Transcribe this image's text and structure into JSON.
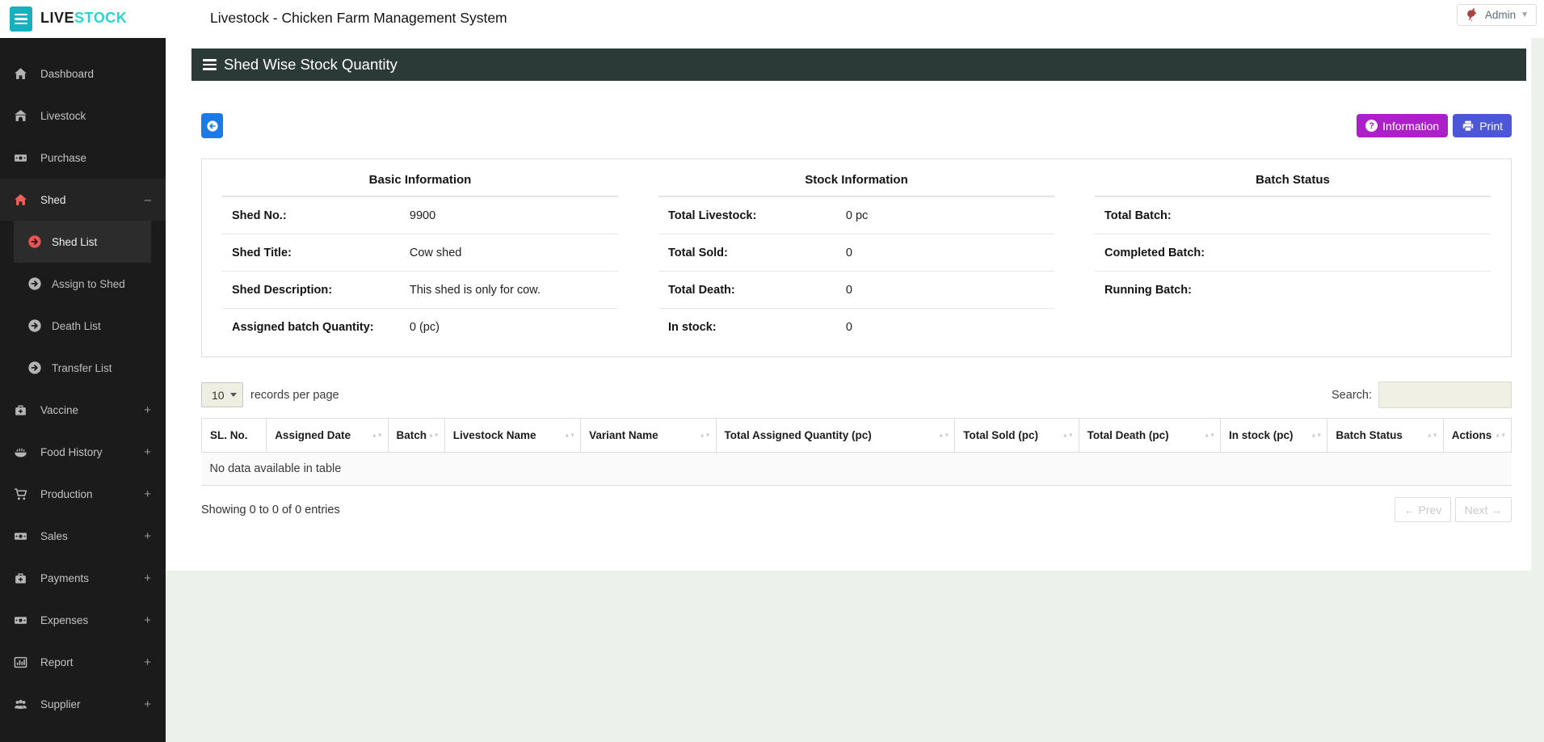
{
  "brand": {
    "logo_prefix": "LIVE",
    "logo_suffix": "STOCK"
  },
  "topbar": {
    "title": "Livestock - Chicken Farm Management System",
    "user_label": "Admin"
  },
  "sidebar": {
    "items": [
      {
        "label": "Dashboard",
        "icon": "home-icon"
      },
      {
        "label": "Livestock",
        "icon": "barn-icon"
      },
      {
        "label": "Purchase",
        "icon": "money-icon"
      },
      {
        "label": "Shed",
        "icon": "home-icon",
        "toggle": "–",
        "state": "expanded",
        "children": [
          {
            "label": "Shed List",
            "active": true
          },
          {
            "label": "Assign to Shed"
          },
          {
            "label": "Death List"
          },
          {
            "label": "Transfer List"
          }
        ]
      },
      {
        "label": "Vaccine",
        "icon": "medkit-icon",
        "toggle": "+"
      },
      {
        "label": "Food History",
        "icon": "food-bowl-icon",
        "toggle": "+"
      },
      {
        "label": "Production",
        "icon": "cart-icon",
        "toggle": "+"
      },
      {
        "label": "Sales",
        "icon": "money-icon",
        "toggle": "+"
      },
      {
        "label": "Payments",
        "icon": "medkit-icon",
        "toggle": "+"
      },
      {
        "label": "Expenses",
        "icon": "money-icon",
        "toggle": "+"
      },
      {
        "label": "Report",
        "icon": "bar-chart-icon",
        "toggle": "+"
      },
      {
        "label": "Supplier",
        "icon": "users-icon",
        "toggle": "+"
      }
    ]
  },
  "panel": {
    "title": "Shed Wise Stock Quantity"
  },
  "toolbar": {
    "information_label": "Information",
    "print_label": "Print"
  },
  "info": {
    "sections": [
      {
        "title": "Basic Information",
        "rows": [
          {
            "label": "Shed No.:",
            "value": "9900"
          },
          {
            "label": "Shed Title:",
            "value": "Cow shed"
          },
          {
            "label": "Shed Description:",
            "value": "This shed is only for cow."
          },
          {
            "label": "Assigned batch Quantity:",
            "value": "0 (pc)"
          }
        ]
      },
      {
        "title": "Stock Information",
        "rows": [
          {
            "label": "Total Livestock:",
            "value": "0 pc"
          },
          {
            "label": "Total Sold:",
            "value": "0"
          },
          {
            "label": "Total Death:",
            "value": "0"
          },
          {
            "label": "In stock:",
            "value": "0"
          }
        ]
      },
      {
        "title": "Batch Status",
        "rows": [
          {
            "label": "Total Batch:",
            "value": ""
          },
          {
            "label": "Completed Batch:",
            "value": ""
          },
          {
            "label": "Running Batch:",
            "value": ""
          }
        ]
      }
    ]
  },
  "table": {
    "length_value": "10",
    "length_label": "records per page",
    "search_label": "Search:",
    "columns": [
      {
        "label": "SL. No.",
        "sortable": false
      },
      {
        "label": "Assigned Date",
        "sortable": true
      },
      {
        "label": "Batch",
        "sortable": true
      },
      {
        "label": "Livestock Name",
        "sortable": true
      },
      {
        "label": "Variant Name",
        "sortable": true
      },
      {
        "label": "Total Assigned Quantity (pc)",
        "sortable": true
      },
      {
        "label": "Total Sold (pc)",
        "sortable": true
      },
      {
        "label": "Total Death (pc)",
        "sortable": true
      },
      {
        "label": "In stock (pc)",
        "sortable": true
      },
      {
        "label": "Batch Status",
        "sortable": true
      },
      {
        "label": "Actions",
        "sortable": true
      }
    ],
    "empty_text": "No data available in table",
    "summary": "Showing 0 to 0 of 0 entries",
    "prev_label": "← Prev",
    "next_label": "Next →"
  },
  "colors": {
    "brand_teal": "#17b0be",
    "logo_accent": "#26d7d2",
    "active_red": "#ef5350",
    "panel_header": "#2c3a37",
    "information_button": "#ac1fc9",
    "print_button": "#4d56d6",
    "back_button": "#1b79e8",
    "sidebar_bg": "#1b1b1b",
    "page_bg": "#edf1ec"
  }
}
